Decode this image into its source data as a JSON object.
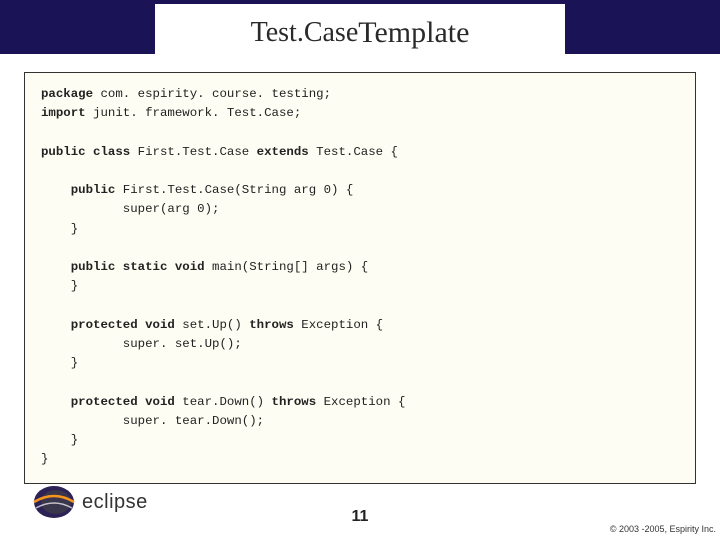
{
  "title": {
    "part1": "Test.Case ",
    "part2": "Template"
  },
  "code": {
    "pkg_kw": "package",
    "pkg_name": " com. espirity. course. testing;",
    "imp_kw": "import",
    "imp_name": " junit. framework. Test.Case;",
    "l1a": "public",
    "l1b": " class",
    "l1c": " First.Test.Case ",
    "l1d": "extends",
    "l1e": " Test.Case {",
    "l2a": "public",
    "l2b": " First.Test.Case(String arg 0) {",
    "l2c": "super(arg 0);",
    "l2d": "}",
    "l3a": "public",
    "l3b": " static",
    "l3c": " void",
    "l3d": " main(String[] args) {",
    "l3e": "}",
    "l4a": "protected",
    "l4b": " void",
    "l4c": " set.Up() ",
    "l4d": "throws",
    "l4e": " Exception {",
    "l4f": "super. set.Up();",
    "l4g": "}",
    "l5a": "protected",
    "l5b": " void",
    "l5c": " tear.Down() ",
    "l5d": "throws",
    "l5e": " Exception {",
    "l5f": "super. tear.Down();",
    "l5g": "}",
    "end": "}"
  },
  "logo_text": "eclipse",
  "page_number": "11",
  "copyright": "© 2003 -2005, Espirity Inc."
}
